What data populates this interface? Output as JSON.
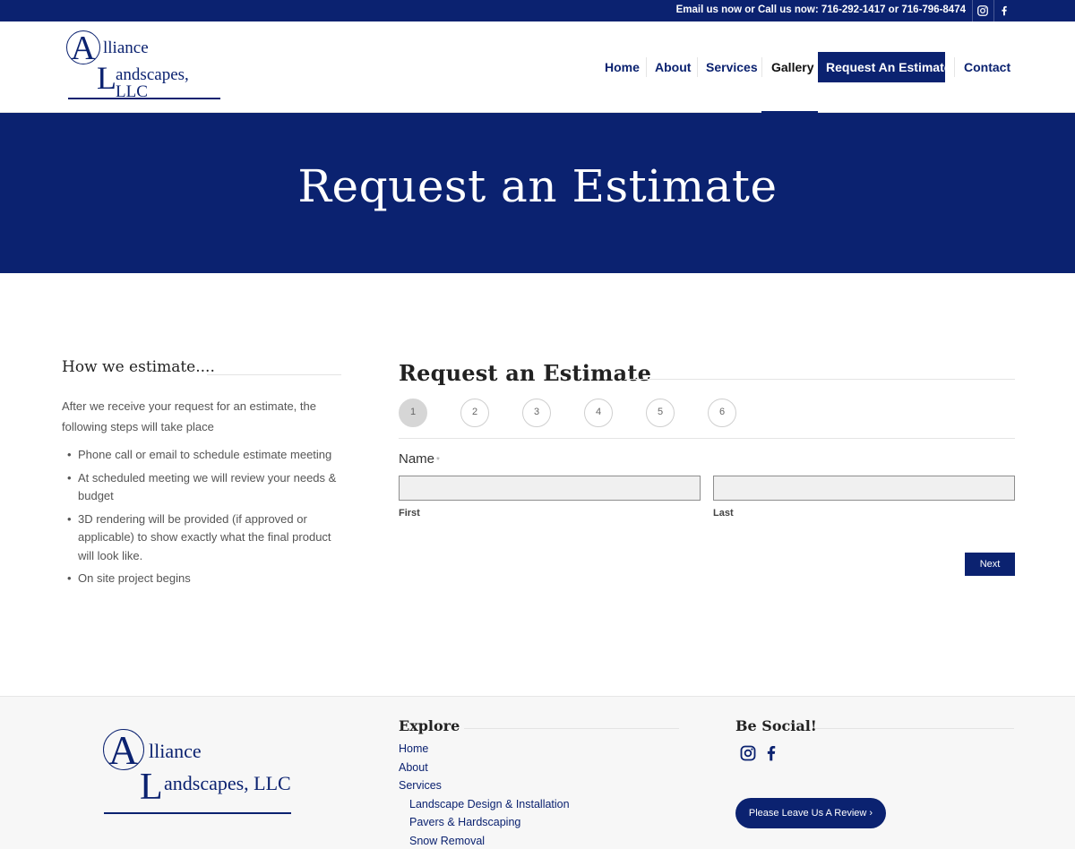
{
  "topbar": {
    "contact_text": "Email us now or Call us now: 716-292-1417 or 716-796-8474",
    "icons": [
      "instagram-icon",
      "facebook-icon"
    ]
  },
  "logo": {
    "big_a": "A",
    "line1": "lliance",
    "big_l": "L",
    "line2": "andscapes, LLC"
  },
  "nav": {
    "items": [
      {
        "label": "Home"
      },
      {
        "label": "About"
      },
      {
        "label": "Services"
      },
      {
        "label": "Gallery"
      },
      {
        "label": "Request An Estimate"
      },
      {
        "label": "Contact"
      }
    ]
  },
  "hero": {
    "title": "Request an Estimate"
  },
  "how": {
    "title": "How we estimate....",
    "intro": "After we receive your request for an estimate, the following steps will take place",
    "steps": [
      "Phone call or email to schedule estimate meeting",
      "At scheduled meeting we will review your needs & budget",
      "3D rendering will be provided (if approved or applicable) to show exactly what the final product will look like.",
      "On site project begins"
    ]
  },
  "form": {
    "title": "Request an Estimate",
    "steps": [
      "1",
      "2",
      "3",
      "4",
      "5",
      "6"
    ],
    "current_step": 1,
    "name_label": "Name",
    "required_mark": "*",
    "first_label": "First",
    "last_label": "Last",
    "first_value": "",
    "last_value": "",
    "next_label": "Next"
  },
  "footer": {
    "explore_title": "Explore",
    "links": [
      "Home",
      "About",
      "Services"
    ],
    "sublinks": [
      "Landscape Design & Installation",
      "Pavers & Hardscaping",
      "Snow Removal"
    ],
    "social_title": "Be Social!",
    "review_label": "Please Leave Us A Review ›"
  },
  "colors": {
    "brand_navy": "#0b2270",
    "footer_bg": "#f7f7f7"
  }
}
